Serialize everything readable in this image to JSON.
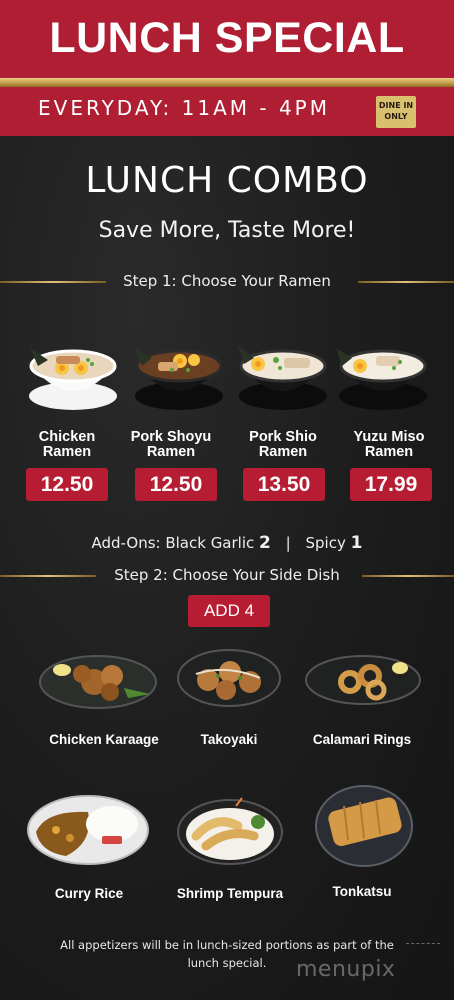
{
  "header": {
    "title": "LUNCH SPECIAL",
    "hours": "EVERYDAY: 11AM - 4PM",
    "badge_line1": "DINE IN",
    "badge_line2": "ONLY"
  },
  "combo": {
    "title": "LUNCH COMBO",
    "subtitle": "Save More, Taste More!"
  },
  "step1": {
    "label": "Step 1: Choose Your Ramen"
  },
  "ramens": [
    {
      "name_line1": "Chicken",
      "name_line2": "Ramen",
      "price": "12.50",
      "broth": "#e8d7bd"
    },
    {
      "name_line1": "Pork Shoyu",
      "name_line2": "Ramen",
      "price": "12.50",
      "broth": "#6b3f22"
    },
    {
      "name_line1": "Pork Shio",
      "name_line2": "Ramen",
      "price": "13.50",
      "broth": "#efe6d6"
    },
    {
      "name_line1": "Yuzu Miso",
      "name_line2": "Ramen",
      "price": "17.99",
      "broth": "#f3ede1"
    }
  ],
  "addons": {
    "prefix": "Add-Ons: Black Garlic",
    "garlic_price": "2",
    "divider": "|",
    "spicy_label": "Spicy",
    "spicy_price": "1"
  },
  "step2": {
    "label": "Step 2: Choose Your Side Dish",
    "add_button": "ADD 4"
  },
  "sides": [
    {
      "name": "Chicken Karaage"
    },
    {
      "name": "Takoyaki"
    },
    {
      "name": "Calamari  Rings"
    },
    {
      "name": "Curry Rice"
    },
    {
      "name": "Shrimp Tempura"
    },
    {
      "name": "Tonkatsu"
    }
  ],
  "footnote": {
    "line1": "All appetizers will be in lunch-sized portions as part of the",
    "line2": "lunch special."
  },
  "watermark": "menupix",
  "colors": {
    "brand_red": "#b01e33",
    "gold": "#d9c06f",
    "board": "#1b1b1b"
  }
}
